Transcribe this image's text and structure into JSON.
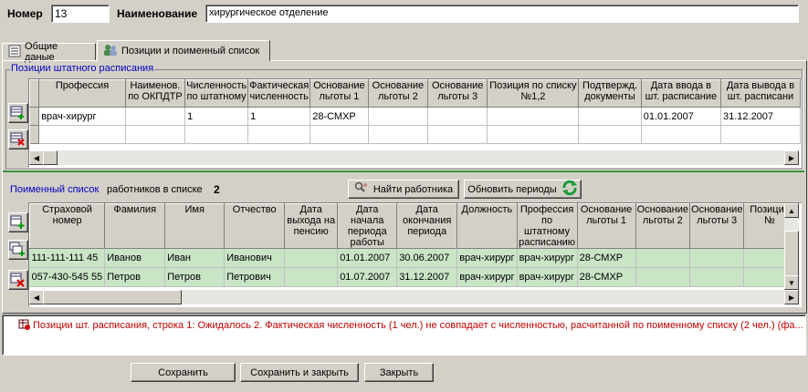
{
  "header": {
    "number_label": "Номер",
    "number_value": "13",
    "name_label": "Наименование",
    "name_value": "хирургическое отделение"
  },
  "tabs": [
    {
      "label": "Общие даные",
      "icon": "list-icon"
    },
    {
      "label": "Позиции и поименный список",
      "icon": "people-icon"
    }
  ],
  "positions": {
    "title": "Позиции штатного расписания",
    "columns": [
      "Профессия",
      "Наименов. по ОКПДТР",
      "Численность по штатному",
      "Фактическая численность",
      "Основание льготы 1",
      "Основание льготы 2",
      "Основание льготы 3",
      "Позиция по списку №1,2",
      "Подтвержд. документы",
      "Дата ввода в шт. расписание",
      "Дата вывода в шт. расписани"
    ],
    "rows": [
      [
        "врач-хирург",
        "",
        "1",
        "1",
        "28-СМХР",
        "",
        "",
        "",
        "",
        "01.01.2007",
        "31.12.2007"
      ]
    ]
  },
  "workers": {
    "title": "Поименный список",
    "count_label": "работников в списке",
    "count": "2",
    "find_button": "Найти работника",
    "refresh_button": "Обновить периоды",
    "columns": [
      "Страховой номер",
      "Фамилия",
      "Имя",
      "Отчество",
      "Дата выхода на пенсию",
      "Дата начала периода работы",
      "Дата окончания периода",
      "Должность",
      "Профессия по штатному расписанию",
      "Основание льготы 1",
      "Основание льготы 2",
      "Основание льготы 3",
      "Позиция №"
    ],
    "rows": [
      [
        "111-111-111 45",
        "Иванов",
        "Иван",
        "Иванович",
        "",
        "01.01.2007",
        "30.06.2007",
        "врач-хирург",
        "врач-хирург",
        "28-СМХР",
        "",
        "",
        ""
      ],
      [
        "057-430-545 55",
        "Петров",
        "Петров",
        "Петрович",
        "",
        "01.07.2007",
        "31.12.2007",
        "врач-хирург",
        "врач-хирург",
        "28-СМХР",
        "",
        "",
        ""
      ]
    ]
  },
  "messages": [
    "Позиции шт. расписания, строка 1: Ожидалось 2. Фактическая численность (1 чел.) не совпадает с численностью, расчитанной по поименному списку (2 чел.) (фа..."
  ],
  "footer": {
    "save": "Сохранить",
    "save_close": "Сохранить и закрыть",
    "close": "Закрыть"
  },
  "colors": {
    "window_bg": "#d4d0c8",
    "row_highlight": "#c9e5c6",
    "section_title": "#0000c0",
    "message_text": "#c00000"
  }
}
